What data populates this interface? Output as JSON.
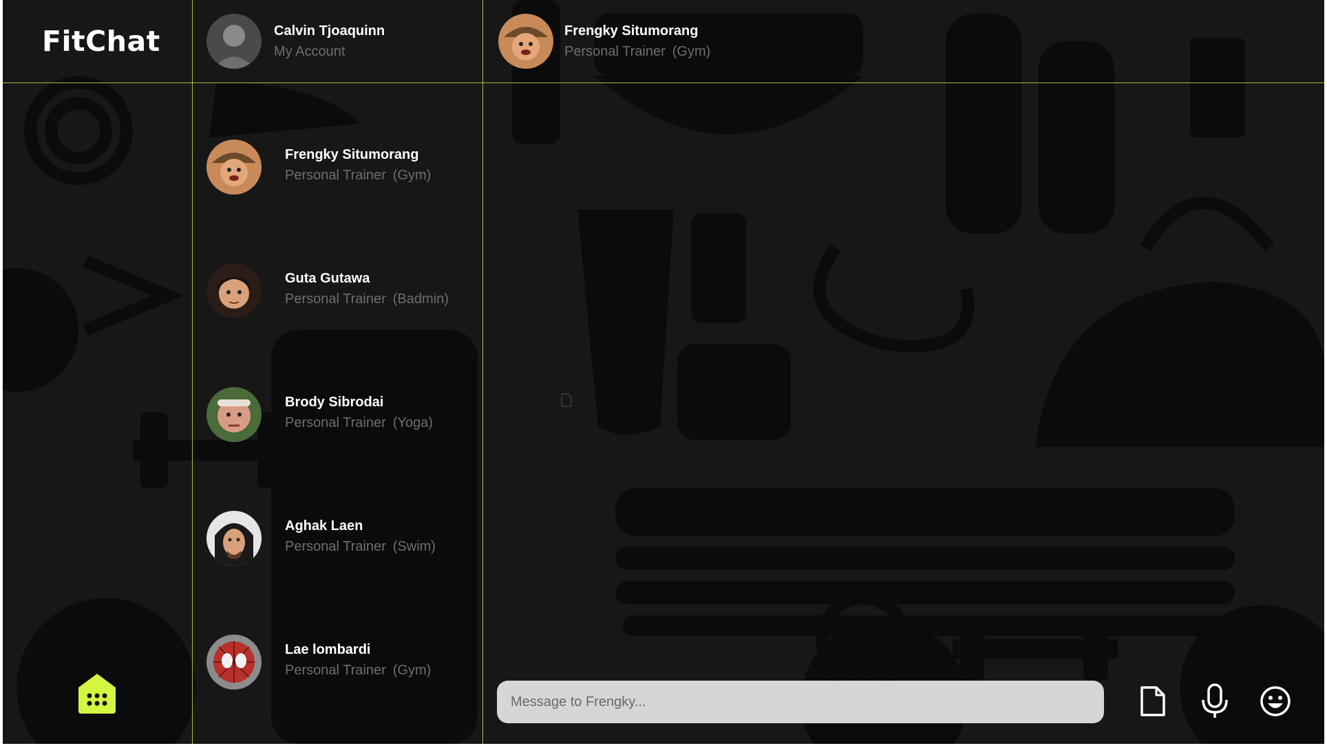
{
  "app": {
    "logo": "FitChat"
  },
  "account": {
    "name": "Calvin Tjoaquinn",
    "subtitle": "My Account"
  },
  "active_chat": {
    "name": "Frengky Situmorang",
    "role": "Personal Trainer",
    "specialty": "(Gym)"
  },
  "contacts": [
    {
      "name": "Frengky Situmorang",
      "role": "Personal Trainer",
      "specialty": "(Gym)"
    },
    {
      "name": "Guta Gutawa",
      "role": "Personal Trainer",
      "specialty": "(Badmin)"
    },
    {
      "name": "Brody Sibrodai",
      "role": "Personal Trainer",
      "specialty": "(Yoga)"
    },
    {
      "name": "Aghak Laen",
      "role": "Personal Trainer",
      "specialty": "(Swim)"
    },
    {
      "name": "Lae lombardi",
      "role": "Personal Trainer",
      "specialty": "(Gym)"
    }
  ],
  "composer": {
    "placeholder": "Message to Frengky..."
  },
  "icons": {
    "home": "apps-grid-icon",
    "attach": "document-icon",
    "voice": "microphone-icon",
    "emoji": "smiley-icon"
  },
  "colors": {
    "accent": "#d4f542",
    "background": "#171717",
    "divider": "#c7d84a",
    "input_bg": "#d6d6d6"
  }
}
